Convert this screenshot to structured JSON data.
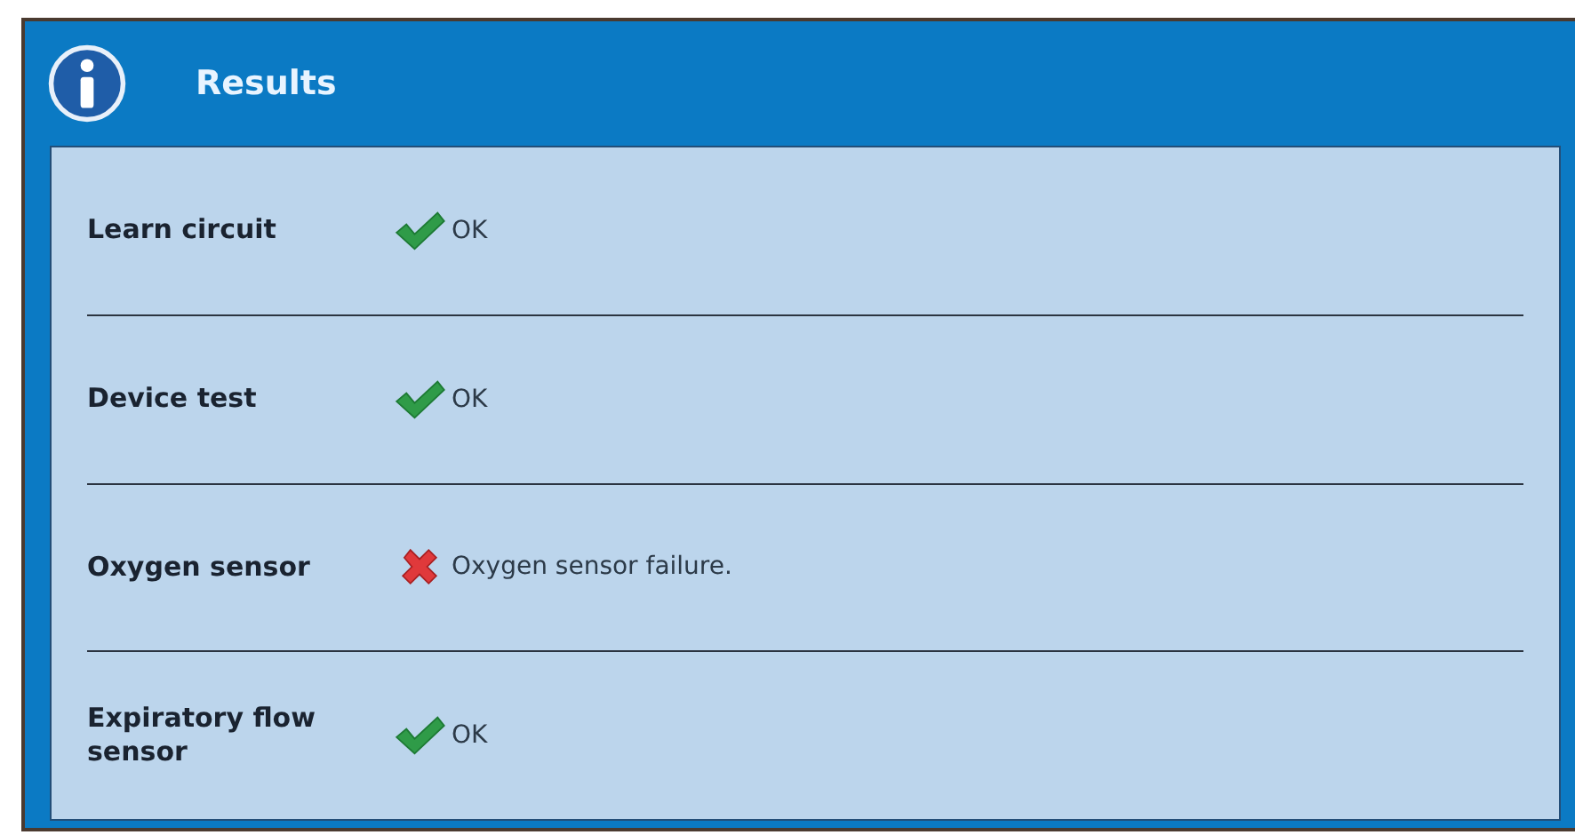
{
  "window": {
    "title": "Results"
  },
  "results": [
    {
      "name": "Learn circuit",
      "kind": "pass",
      "message": "OK"
    },
    {
      "name": "Device test",
      "kind": "pass",
      "message": "OK"
    },
    {
      "name": "Oxygen sensor",
      "kind": "fail",
      "message": "Oxygen sensor failure."
    },
    {
      "name": "Expiratory flow sensor",
      "kind": "pass",
      "message": "OK"
    }
  ]
}
